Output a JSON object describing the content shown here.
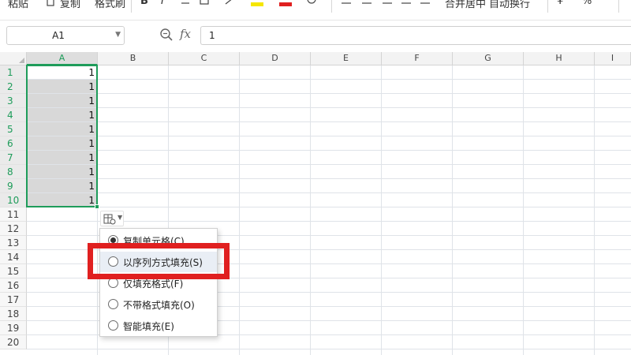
{
  "toolbar": {
    "paste_label": "粘贴",
    "copy_label": "复制",
    "format_painter_label": "格式刷",
    "bold_label": "B",
    "italic_label": "I",
    "merge_label": "合并居中",
    "wrap_label": "自动换行",
    "currency_label": "¥",
    "percent_label": "%",
    "accent_color": "#1e9c5a"
  },
  "formula_bar": {
    "cell_ref": "A1",
    "fx_label": "fx",
    "value": "1",
    "zoom_icon": "zoom-icon"
  },
  "columns": [
    "A",
    "B",
    "C",
    "D",
    "E",
    "F",
    "G",
    "H",
    "I"
  ],
  "rows": [
    "1",
    "2",
    "3",
    "4",
    "5",
    "6",
    "7",
    "8",
    "9",
    "10",
    "11",
    "12",
    "13",
    "14",
    "15",
    "16",
    "17",
    "18",
    "19",
    "20"
  ],
  "cells_a": [
    "1",
    "1",
    "1",
    "1",
    "1",
    "1",
    "1",
    "1",
    "1",
    "1"
  ],
  "autofill_menu": {
    "button_icon": "autofill-options-icon",
    "items": [
      {
        "label": "复制单元格(C)",
        "selected": true
      },
      {
        "label": "以序列方式填充(S)",
        "selected": false
      },
      {
        "label": "仅填充格式(F)",
        "selected": false
      },
      {
        "label": "不带格式填充(O)",
        "selected": false
      },
      {
        "label": "智能填充(E)",
        "selected": false
      }
    ]
  },
  "highlight_color": "#e02020"
}
